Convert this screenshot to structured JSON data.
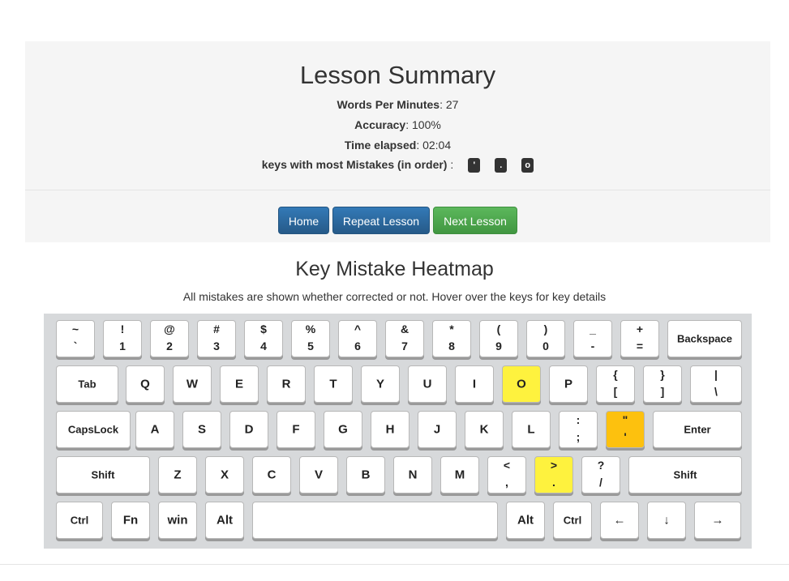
{
  "summary": {
    "title": "Lesson Summary",
    "wpm_label": "Words Per Minutes",
    "wpm_value": ": 27",
    "accuracy_label": "Accuracy",
    "accuracy_value": ": 100%",
    "time_label": "Time elapsed",
    "time_value": ": 02:04",
    "mistakes_label": "keys with most Mistakes (in order)",
    "mistakes_sep": " :",
    "mistake_keys": [
      "'",
      ".",
      "o"
    ]
  },
  "buttons": {
    "home": "Home",
    "repeat": "Repeat Lesson",
    "next": "Next Lesson"
  },
  "heatmap": {
    "title": "Key Mistake Heatmap",
    "note": "All mistakes are shown whether corrected or not. Hover over the keys for key details"
  },
  "colors": {
    "mistake_low": "#fef23e",
    "mistake_high": "#fdc10e"
  },
  "keyboard": {
    "row1": [
      {
        "t": "~",
        "b": "`"
      },
      {
        "t": "!",
        "b": "1"
      },
      {
        "t": "@",
        "b": "2"
      },
      {
        "t": "#",
        "b": "3"
      },
      {
        "t": "$",
        "b": "4"
      },
      {
        "t": "%",
        "b": "5"
      },
      {
        "t": "^",
        "b": "6"
      },
      {
        "t": "&",
        "b": "7"
      },
      {
        "t": "*",
        "b": "8"
      },
      {
        "t": "(",
        "b": "9"
      },
      {
        "t": ")",
        "b": "0"
      },
      {
        "t": "_",
        "b": "-"
      },
      {
        "t": "+",
        "b": "="
      },
      {
        "c": "Backspace"
      }
    ],
    "row2": [
      {
        "c": "Tab"
      },
      {
        "c": "Q"
      },
      {
        "c": "W"
      },
      {
        "c": "E"
      },
      {
        "c": "R"
      },
      {
        "c": "T"
      },
      {
        "c": "Y"
      },
      {
        "c": "U"
      },
      {
        "c": "I"
      },
      {
        "c": "O",
        "heat": "yellow"
      },
      {
        "c": "P"
      },
      {
        "t": "{",
        "b": "["
      },
      {
        "t": "}",
        "b": "]"
      },
      {
        "t": "|",
        "b": "\\"
      }
    ],
    "row3": [
      {
        "c": "CapsLock"
      },
      {
        "c": "A"
      },
      {
        "c": "S"
      },
      {
        "c": "D"
      },
      {
        "c": "F"
      },
      {
        "c": "G"
      },
      {
        "c": "H"
      },
      {
        "c": "J"
      },
      {
        "c": "K"
      },
      {
        "c": "L"
      },
      {
        "t": ":",
        "b": ";"
      },
      {
        "t": "\"",
        "b": "'",
        "heat": "orange"
      },
      {
        "c": "Enter"
      }
    ],
    "row4": [
      {
        "c": "Shift"
      },
      {
        "c": "Z"
      },
      {
        "c": "X"
      },
      {
        "c": "C"
      },
      {
        "c": "V"
      },
      {
        "c": "B"
      },
      {
        "c": "N"
      },
      {
        "c": "M"
      },
      {
        "t": "<",
        "b": ","
      },
      {
        "t": ">",
        "b": ".",
        "heat": "yellow"
      },
      {
        "t": "?",
        "b": "/"
      },
      {
        "c": "Shift"
      }
    ],
    "row5": [
      {
        "c": "Ctrl"
      },
      {
        "c": "Fn"
      },
      {
        "c": "win"
      },
      {
        "c": "Alt"
      },
      {
        "c": ""
      },
      {
        "c": "Alt"
      },
      {
        "c": "Ctrl"
      },
      {
        "c": "←"
      },
      {
        "c": "↓"
      },
      {
        "c": "→"
      }
    ]
  }
}
